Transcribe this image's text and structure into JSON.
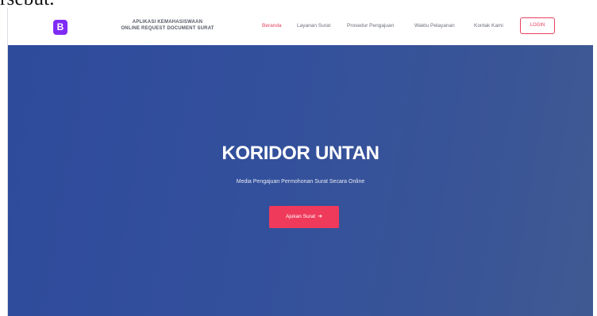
{
  "caption_fragment": "rsebut.",
  "navbar": {
    "logo_letter": "B",
    "brand_line1": "APLIKASI KEMAHASISWAAN",
    "brand_line2": "ONLINE REQUEST DOCUMENT SURAT",
    "links": [
      {
        "label": "Beranda",
        "active": true
      },
      {
        "label": "Layanan Surat",
        "active": false
      },
      {
        "label": "Prosedur Pengajuan",
        "active": false
      },
      {
        "label": "Waktu Pelayanan",
        "active": false
      },
      {
        "label": "Kontak Kami",
        "active": false
      }
    ],
    "login_label": "LOGIN"
  },
  "hero": {
    "title": "KORIDOR UNTAN",
    "subtitle": "Media Pengajuan Permohonan Surat Secara Online",
    "cta_label": "Ajukan Surat",
    "cta_icon": "arrow-right-icon"
  },
  "colors": {
    "accent": "#e8405e",
    "brand_logo": "#7e2cf5",
    "hero_bg": "#32509b",
    "cta_bg": "#ef3a5b"
  }
}
